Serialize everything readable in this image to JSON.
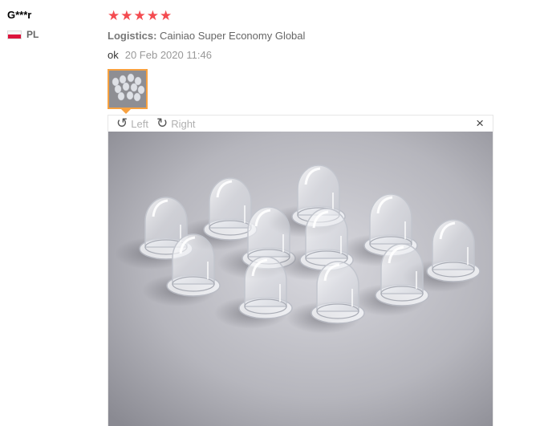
{
  "review": {
    "user_name": "G***r",
    "country_code": "PL",
    "rating": 5,
    "stars": [
      "★",
      "★",
      "★",
      "★",
      "★"
    ],
    "logistics_label": "Logistics:",
    "logistics_value": "Cainiao Super Economy Global",
    "feedback_text": "ok",
    "feedback_date": "20 Feb 2020 11:46"
  },
  "viewer": {
    "rotate_left_label": "Left",
    "rotate_right_label": "Right",
    "close_symbol": "×"
  },
  "icons": {
    "rotate_left": "rotate-left-icon",
    "rotate_right": "rotate-right-icon",
    "close": "close-icon",
    "flag": "poland-flag-icon",
    "star": "star-icon"
  },
  "colors": {
    "star": "#f44b50",
    "thumb_border": "#f7a140",
    "muted_text": "#999999"
  }
}
